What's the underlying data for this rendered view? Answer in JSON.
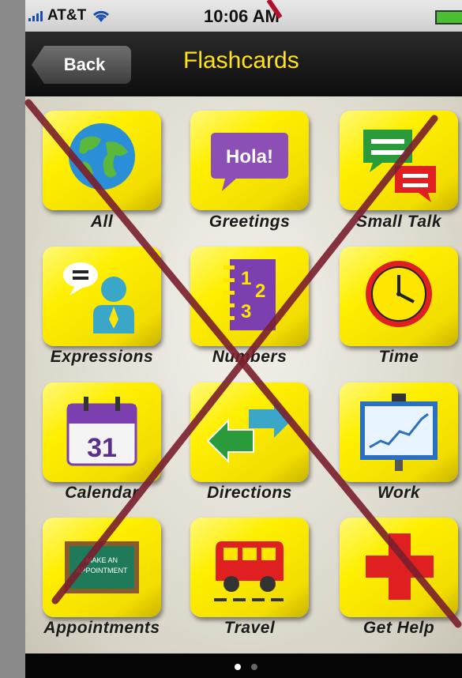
{
  "status_bar": {
    "carrier": "AT&T",
    "time": "10:06 AM"
  },
  "nav": {
    "back_label": "Back",
    "title": "Flashcards"
  },
  "tiles": [
    {
      "label": "All",
      "icon": "globe-icon"
    },
    {
      "label": "Greetings",
      "icon": "hola-speech-bubble-icon",
      "icon_text": "Hola!"
    },
    {
      "label": "Small Talk",
      "icon": "chat-bubbles-icon"
    },
    {
      "label": "Expressions",
      "icon": "person-speaking-icon"
    },
    {
      "label": "Numbers",
      "icon": "numbers-notebook-icon"
    },
    {
      "label": "Time",
      "icon": "clock-icon"
    },
    {
      "label": "Calendar",
      "icon": "calendar-icon",
      "icon_text": "31"
    },
    {
      "label": "Directions",
      "icon": "arrows-icon"
    },
    {
      "label": "Work",
      "icon": "chart-board-icon"
    },
    {
      "label": "Appointments",
      "icon": "chalkboard-icon",
      "icon_text": "MAKE AN APPOINTMENT"
    },
    {
      "label": "Travel",
      "icon": "bus-icon"
    },
    {
      "label": "Get Help",
      "icon": "red-cross-icon"
    }
  ],
  "page_indicator": {
    "current": 1,
    "total": 2
  },
  "colors": {
    "tile_yellow": "#ffef00",
    "title_yellow": "#ffe219",
    "cross_red": "#7a1f2e"
  }
}
